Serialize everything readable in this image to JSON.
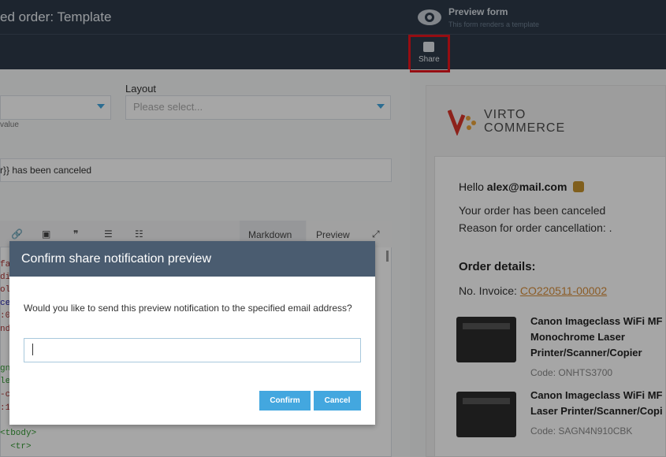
{
  "header": {
    "title": "ed order: Template",
    "preview_title": "Preview form",
    "preview_subtitle": "This form renders a template",
    "share_label": "Share"
  },
  "form": {
    "layout_label": "Layout",
    "layout_placeholder": "Please select...",
    "hint": "value",
    "subject_text": "r}} has been canceled"
  },
  "editor": {
    "tab_markdown": "Markdown",
    "tab_preview": "Preview",
    "code_lines": [
      "fa",
      "di",
      "ol",
      "ce",
      ":0",
      "nd",
      "gn",
      "le",
      "-c",
      ":1",
      "<tbody>",
      "  <tr>"
    ]
  },
  "preview": {
    "logo_line1": "VIRTO",
    "logo_line2": "COMMERCE",
    "hello": "Hello",
    "email": "alex@mail.com",
    "line1": "Your order has been canceled",
    "line2": "Reason for order cancellation: .",
    "order_details": "Order details:",
    "invoice_label": "No. Invoice:",
    "invoice_number": "CO220511-00002",
    "products": [
      {
        "name": "Canon Imageclass WiFi MF\nMonochrome Laser\nPrinter/Scanner/Copier",
        "code": "Code: ONHTS3700"
      },
      {
        "name": "Canon Imageclass WiFi MF\nLaser Printer/Scanner/Copi",
        "code": "Code: SAGN4N910CBK"
      }
    ]
  },
  "modal": {
    "title": "Confirm share notification preview",
    "message": "Would you like to send this preview notification to the specified email address?",
    "email_value": "",
    "confirm_label": "Confirm",
    "cancel_label": "Cancel"
  }
}
